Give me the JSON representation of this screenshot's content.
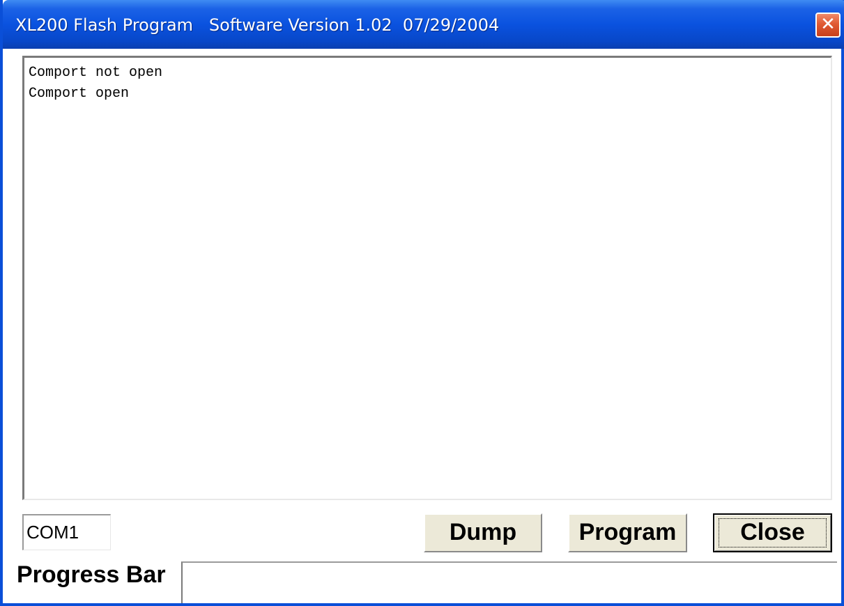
{
  "window": {
    "title": "XL200 Flash Program   Software Version 1.02  07/29/2004",
    "close_glyph": "✕"
  },
  "log": {
    "lines": [
      "Comport not open",
      "Comport open"
    ]
  },
  "controls": {
    "com_port_value": "COM1",
    "dump_label": "Dump",
    "program_label": "Program",
    "close_label": "Close"
  },
  "progress": {
    "label": "Progress Bar",
    "value_fraction": 0
  },
  "colors": {
    "titlebar": "#0a52df",
    "button_face": "#ece9d8",
    "close_button": "#e05a32"
  }
}
